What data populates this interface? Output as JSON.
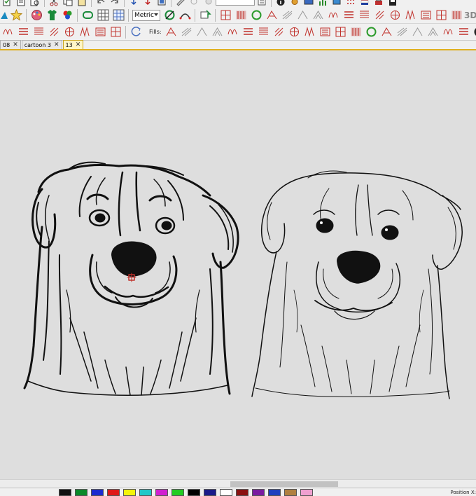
{
  "toolbar": {
    "units_select": {
      "selected": "Metric"
    },
    "label_3d": "3D",
    "fills_label": "Fills:"
  },
  "tabs": [
    {
      "label": "08",
      "close": "✕",
      "active": false
    },
    {
      "label": "cartoon 3",
      "close": "✕",
      "active": false
    },
    {
      "label": "13",
      "close": "✕",
      "active": true
    }
  ],
  "colors": {
    "accent_tab": "#e0b020",
    "stitch_red": "#c0302a",
    "thread_black": "#111111",
    "canvas_bg": "#dedede"
  },
  "palette": [
    "#111111",
    "#0a8a2a",
    "#1b2bd0",
    "#e01818",
    "#f4f40a",
    "#20c8c8",
    "#d020d0",
    "#22cc22",
    "#000000",
    "#1a1a8a",
    "#ffffff",
    "#8a1010",
    "#7a1aa0",
    "#1e3fbf",
    "#b08040",
    "#f0a0d0"
  ],
  "status": {
    "position_label": "Position X:"
  },
  "canvas": {
    "designs": [
      {
        "name": "embroidered-dog-head",
        "style": "stitched"
      },
      {
        "name": "line-art-dog-head",
        "style": "sketch"
      }
    ]
  }
}
